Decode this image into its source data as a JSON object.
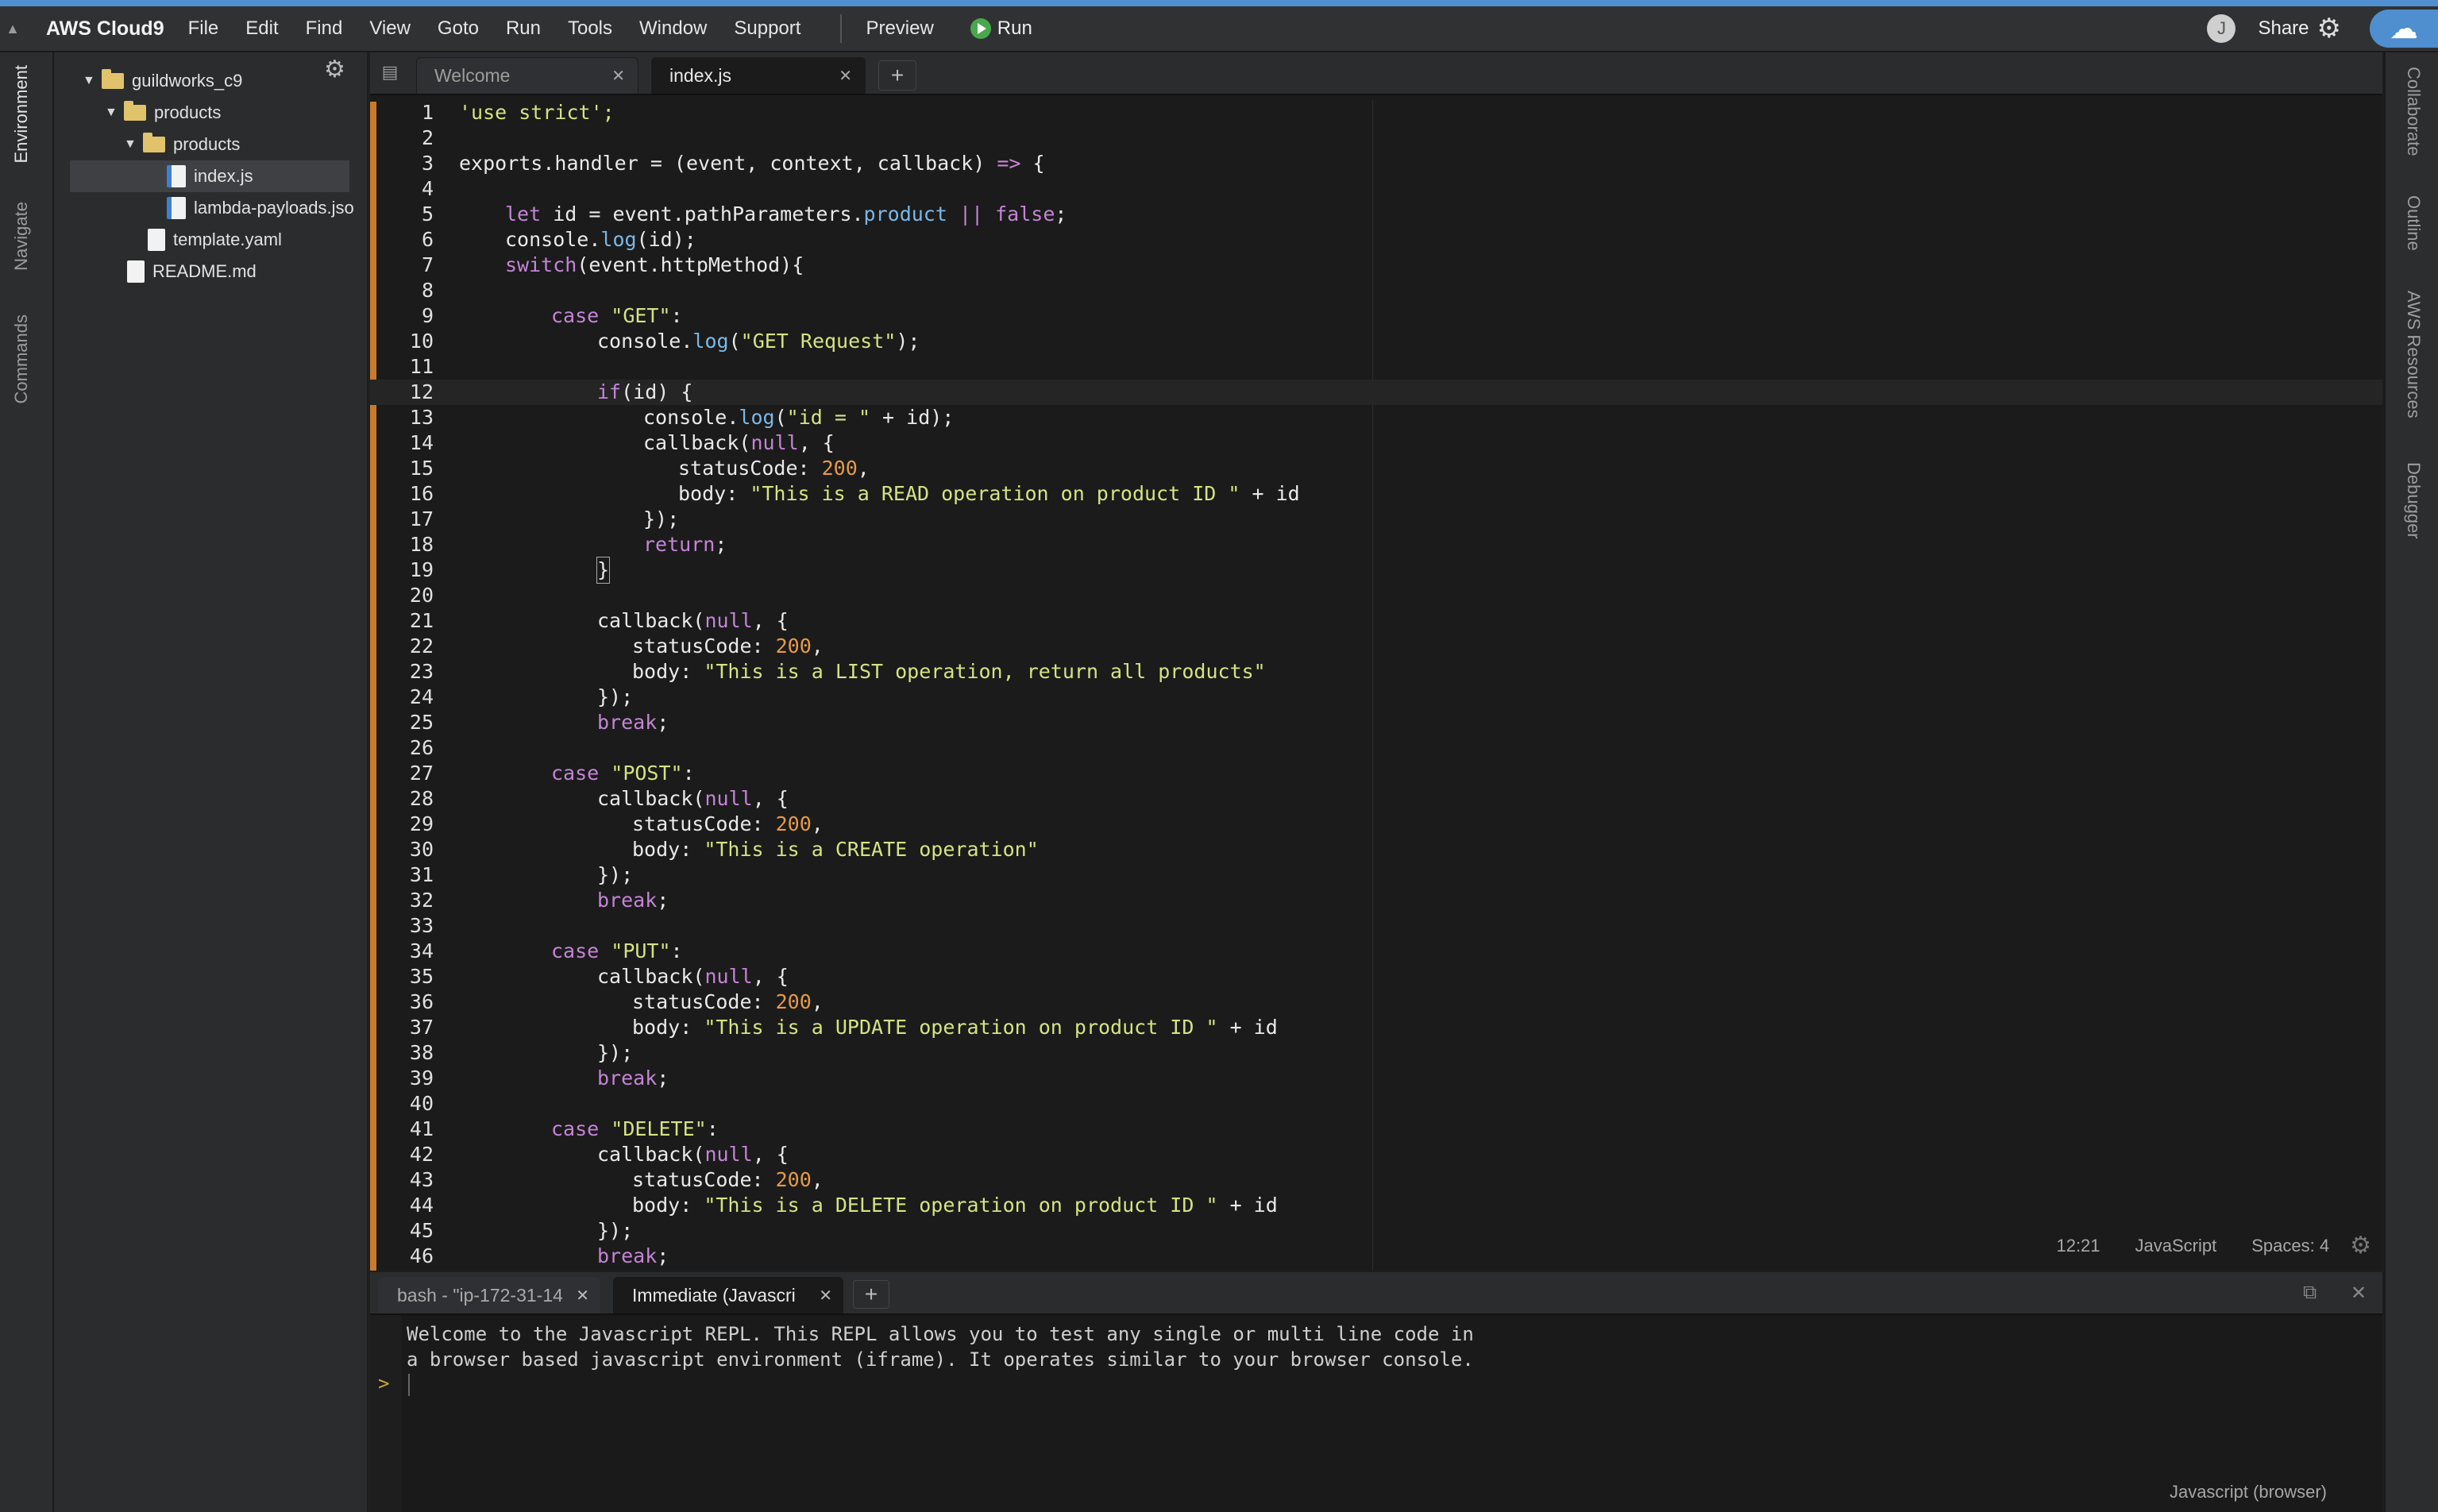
{
  "menubar": {
    "brand": "AWS Cloud9",
    "items": [
      "File",
      "Edit",
      "Find",
      "View",
      "Goto",
      "Run",
      "Tools",
      "Window",
      "Support"
    ],
    "preview": "Preview",
    "run": "Run",
    "avatar_letter": "J",
    "share": "Share"
  },
  "left_panel_tabs": [
    "Environment",
    "Navigate",
    "Commands"
  ],
  "right_panel_tabs": [
    "Collaborate",
    "Outline",
    "AWS Resources",
    "Debugger"
  ],
  "tree": [
    {
      "label": "guildworks_c9",
      "type": "folder"
    },
    {
      "label": "products",
      "type": "folder"
    },
    {
      "label": "products",
      "type": "folder"
    },
    {
      "label": "index.js",
      "type": "js",
      "selected": true
    },
    {
      "label": "lambda-payloads.jso",
      "type": "js"
    },
    {
      "label": "template.yaml",
      "type": "file"
    },
    {
      "label": "README.md",
      "type": "file"
    }
  ],
  "editor_tabs": [
    {
      "label": "Welcome",
      "active": false
    },
    {
      "label": "index.js",
      "active": true
    }
  ],
  "code_lines": [
    "1",
    "2",
    "3",
    "4",
    "5",
    "6",
    "7",
    "8",
    "9",
    "10",
    "11",
    "12",
    "13",
    "14",
    "15",
    "16",
    "17",
    "18",
    "19",
    "20",
    "21",
    "22",
    "23",
    "24",
    "25",
    "26",
    "27",
    "28",
    "29",
    "30",
    "31",
    "32",
    "33",
    "34",
    "35",
    "36",
    "37",
    "38",
    "39",
    "40",
    "41",
    "42",
    "43",
    "44",
    "45",
    "46"
  ],
  "code": {
    "use_strict": "'use strict';",
    "exports": "exports.handler",
    "eq": " = (event, context, callback) ",
    "arrow": "=>",
    "brace": " {",
    "let": "let",
    "id_decl": " id = event.pathParameters.",
    "product": "product",
    "or": " || ",
    "false": "false",
    "semi": ";",
    "console": "console.",
    "log": "log",
    "log_id": "(id);",
    "switch": "switch",
    "switch_rest": "(event.httpMethod){",
    "case": "case",
    "get": "\"GET\"",
    "post": "\"POST\"",
    "put": "\"PUT\"",
    "delete": "\"DELETE\"",
    "colon": ":",
    "get_request": "\"GET Request\"",
    "log_close": ");",
    "if": "if",
    "if_rest": "(id) {",
    "id_eq": "\"id = \"",
    "plus_id": " + id);",
    "callback": "callback(",
    "null": "null",
    "cb_rest": ", {",
    "statusCode": "statusCode: ",
    "200": "200",
    "comma": ",",
    "body": "body: ",
    "read_op": "\"This is a READ operation on product ID \"",
    "plus_id_tail": " + id",
    "close_obj": "});",
    "return": "return",
    "rbrace": "}",
    "list_op": "\"This is a LIST operation, return all products\"",
    "break": "break",
    "create_op": "\"This is a CREATE operation\"",
    "update_op": "\"This is a UPDATE operation on product ID \"",
    "delete_op": "\"This is a DELETE operation on product ID \""
  },
  "status": {
    "position": "12:21",
    "language": "JavaScript",
    "spaces": "Spaces: 4"
  },
  "terminal": {
    "tabs": [
      {
        "label": "bash - \"ip-172-31-14",
        "active": false
      },
      {
        "label": "Immediate (Javascri",
        "active": true
      }
    ],
    "repl_line1": "Welcome to the Javascript REPL. This REPL allows you to test any single or multi line code in",
    "repl_line2": "a browser based javascript environment (iframe). It operates similar to your browser console.",
    "prompt": ">",
    "mode": "Javascript (browser)"
  },
  "colors": {
    "accent": "#4f8fcf",
    "run_green": "#49a84b",
    "folder": "#e0c36a",
    "modified_gutter": "#c97a2d"
  }
}
